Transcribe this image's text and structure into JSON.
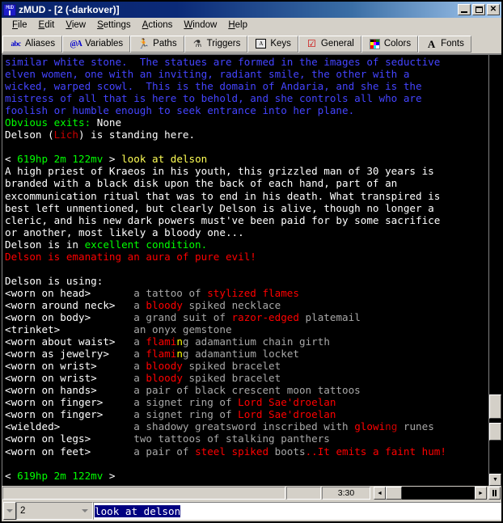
{
  "window": {
    "title": "zMUD - [2 (-darkover)]",
    "icon": "zmud-icon",
    "minimize_label": "Minimize",
    "maximize_label": "Maximize",
    "close_label": "Close"
  },
  "menubar": {
    "items": [
      {
        "label": "File",
        "accel": "F"
      },
      {
        "label": "Edit",
        "accel": "E"
      },
      {
        "label": "View",
        "accel": "V"
      },
      {
        "label": "Settings",
        "accel": "S"
      },
      {
        "label": "Actions",
        "accel": "A"
      },
      {
        "label": "Window",
        "accel": "W"
      },
      {
        "label": "Help",
        "accel": "H"
      }
    ]
  },
  "toolbar": {
    "buttons": [
      {
        "label": "Aliases",
        "icon": "abc-icon",
        "glyph": "abc"
      },
      {
        "label": "Variables",
        "icon": "at-a-icon",
        "glyph": "@A"
      },
      {
        "label": "Paths",
        "icon": "runner-icon",
        "glyph": "☱"
      },
      {
        "label": "Triggers",
        "icon": "trigger-icon",
        "glyph": "♁"
      },
      {
        "label": "Keys",
        "icon": "keyboard-icon",
        "glyph": "A"
      },
      {
        "label": "General",
        "icon": "checkbox-icon",
        "glyph": "☑"
      },
      {
        "label": "Colors",
        "icon": "palette-icon",
        "glyph": ""
      },
      {
        "label": "Fonts",
        "icon": "font-a-icon",
        "glyph": "A"
      }
    ],
    "palette_swatches": [
      "#000000",
      "#800000",
      "#008000",
      "#ffff00",
      "#ff00ff",
      "#0000ff",
      "#ff0000",
      "#00ffff",
      "#ffffff"
    ]
  },
  "output": {
    "lines": [
      [
        {
          "t": "similar white stone.  The statues are formed in the images of seductive",
          "c": "c-blue"
        }
      ],
      [
        {
          "t": "elven women, one with an inviting, radiant smile, the other with a",
          "c": "c-blue"
        }
      ],
      [
        {
          "t": "wicked, warped scowl.  This is the domain of Andaria, and she is the",
          "c": "c-blue"
        }
      ],
      [
        {
          "t": "mistress of all that is here to behold, and she controls all who are",
          "c": "c-blue"
        }
      ],
      [
        {
          "t": "foolish or humble enough to seek entrance into her plane.",
          "c": "c-blue"
        }
      ],
      [
        {
          "t": "Obvious exits:",
          "c": "c-gbold"
        },
        {
          "t": " None",
          "c": "c-wbold"
        }
      ],
      [
        {
          "t": "Delson (",
          "c": "c-wbold"
        },
        {
          "t": "Lich",
          "c": "c-red"
        },
        {
          "t": ") is standing here.",
          "c": "c-wbold"
        }
      ],
      [
        {
          "t": "",
          "c": "c-white"
        }
      ],
      [
        {
          "t": "< ",
          "c": "c-wbold"
        },
        {
          "t": "619hp 2m 122mv",
          "c": "c-gbold"
        },
        {
          "t": " > ",
          "c": "c-wbold"
        },
        {
          "t": "look at delson",
          "c": "c-ybold"
        }
      ],
      [
        {
          "t": "A high priest of Kraeos in his youth, this grizzled man of 30 years is",
          "c": "c-wbold"
        }
      ],
      [
        {
          "t": "branded with a black disk upon the back of each hand, part of an",
          "c": "c-wbold"
        }
      ],
      [
        {
          "t": "excommunication ritual that was to end in his death. What transpired is",
          "c": "c-wbold"
        }
      ],
      [
        {
          "t": "best left unmentioned, but clearly Delson is alive, though no longer a",
          "c": "c-wbold"
        }
      ],
      [
        {
          "t": "cleric, and his new dark powers must've been paid for by some sacrifice",
          "c": "c-wbold"
        }
      ],
      [
        {
          "t": "or another, most likely a bloody one...",
          "c": "c-wbold"
        }
      ],
      [
        {
          "t": "Delson is in ",
          "c": "c-wbold"
        },
        {
          "t": "excellent condition.",
          "c": "c-gbold"
        }
      ],
      [
        {
          "t": "Delson is emanating an aura of pure evil!",
          "c": "c-rbold"
        }
      ],
      [
        {
          "t": "",
          "c": "c-white"
        }
      ],
      [
        {
          "t": "Delson is using:",
          "c": "c-wbold"
        }
      ],
      [
        {
          "t": "<worn on head>",
          "c": "c-wbold"
        },
        {
          "t": "       a tattoo of ",
          "c": "c-gray"
        },
        {
          "t": "stylized flames",
          "c": "c-rbold"
        }
      ],
      [
        {
          "t": "<worn around neck>",
          "c": "c-wbold"
        },
        {
          "t": "   a ",
          "c": "c-gray"
        },
        {
          "t": "bloody",
          "c": "c-rbold"
        },
        {
          "t": " spiked necklace",
          "c": "c-gray"
        }
      ],
      [
        {
          "t": "<worn on body>",
          "c": "c-wbold"
        },
        {
          "t": "       a grand suit of ",
          "c": "c-gray"
        },
        {
          "t": "razor-edged",
          "c": "c-rbold"
        },
        {
          "t": " platemail",
          "c": "c-gray"
        }
      ],
      [
        {
          "t": "<trinket>",
          "c": "c-wbold"
        },
        {
          "t": "            an onyx gemstone",
          "c": "c-gray"
        }
      ],
      [
        {
          "t": "<worn about waist>",
          "c": "c-wbold"
        },
        {
          "t": "   a ",
          "c": "c-gray"
        },
        {
          "t": "flami",
          "c": "c-rbold"
        },
        {
          "t": "n",
          "c": "c-yellow"
        },
        {
          "t": "g",
          "c": "c-gray"
        },
        {
          "t": " adamantium chain girth",
          "c": "c-gray"
        }
      ],
      [
        {
          "t": "<worn as jewelry>",
          "c": "c-wbold"
        },
        {
          "t": "    a ",
          "c": "c-gray"
        },
        {
          "t": "flami",
          "c": "c-rbold"
        },
        {
          "t": "n",
          "c": "c-yellow"
        },
        {
          "t": "g",
          "c": "c-gray"
        },
        {
          "t": " adamantium locket",
          "c": "c-gray"
        }
      ],
      [
        {
          "t": "<worn on wrist>",
          "c": "c-wbold"
        },
        {
          "t": "      a ",
          "c": "c-gray"
        },
        {
          "t": "bloody",
          "c": "c-rbold"
        },
        {
          "t": " spiked bracelet",
          "c": "c-gray"
        }
      ],
      [
        {
          "t": "<worn on wrist>",
          "c": "c-wbold"
        },
        {
          "t": "      a ",
          "c": "c-gray"
        },
        {
          "t": "bloody",
          "c": "c-rbold"
        },
        {
          "t": " spiked bracelet",
          "c": "c-gray"
        }
      ],
      [
        {
          "t": "<worn on hands>",
          "c": "c-wbold"
        },
        {
          "t": "      a pair of black crescent moon tattoos",
          "c": "c-gray"
        }
      ],
      [
        {
          "t": "<worn on finger>",
          "c": "c-wbold"
        },
        {
          "t": "     a signet ring of ",
          "c": "c-gray"
        },
        {
          "t": "Lord Sae'droelan",
          "c": "c-rbold"
        }
      ],
      [
        {
          "t": "<worn on finger>",
          "c": "c-wbold"
        },
        {
          "t": "     a signet ring of ",
          "c": "c-gray"
        },
        {
          "t": "Lord Sae'droelan",
          "c": "c-rbold"
        }
      ],
      [
        {
          "t": "<wielded>",
          "c": "c-wbold"
        },
        {
          "t": "            a shadowy greatsword inscribed with ",
          "c": "c-gray"
        },
        {
          "t": "glowi",
          "c": "c-rbold"
        },
        {
          "t": "ng",
          "c": "c-red"
        },
        {
          "t": " runes",
          "c": "c-gray"
        }
      ],
      [
        {
          "t": "<worn on legs>",
          "c": "c-wbold"
        },
        {
          "t": "       two tattoos of stalking panthers",
          "c": "c-gray"
        }
      ],
      [
        {
          "t": "<worn on feet>",
          "c": "c-wbold"
        },
        {
          "t": "       a pair of ",
          "c": "c-gray"
        },
        {
          "t": "steel spiked",
          "c": "c-rbold"
        },
        {
          "t": " boots",
          "c": "c-gray"
        },
        {
          "t": "..It emits a faint hum!",
          "c": "c-rbold"
        }
      ],
      [
        {
          "t": "",
          "c": "c-white"
        }
      ],
      [
        {
          "t": "< ",
          "c": "c-wbold"
        },
        {
          "t": "619hp 2m 122mv",
          "c": "c-gbold"
        },
        {
          "t": " >",
          "c": "c-wbold"
        }
      ]
    ]
  },
  "statusbar": {
    "main_text": "",
    "small_text": "",
    "timer": "3:30",
    "scroll_left_label": "◄",
    "scroll_right_label": "►",
    "pause_label": "Pause"
  },
  "commandbar": {
    "session_value": "2",
    "input_value": "look at delson",
    "input_placeholder": "",
    "spinner_label": "▼"
  },
  "scrollbars": {
    "vertical_up": "▲",
    "vertical_down": "▼"
  },
  "colors": {
    "title_start": "#0a246a",
    "title_end": "#a6caf0",
    "chrome": "#d4d0c8",
    "terminal_bg": "#000000",
    "accent_green": "#00ff00",
    "accent_red": "#ff0000",
    "accent_blue": "#4444ff",
    "accent_yellow": "#ffff55",
    "selection": "#000080"
  }
}
